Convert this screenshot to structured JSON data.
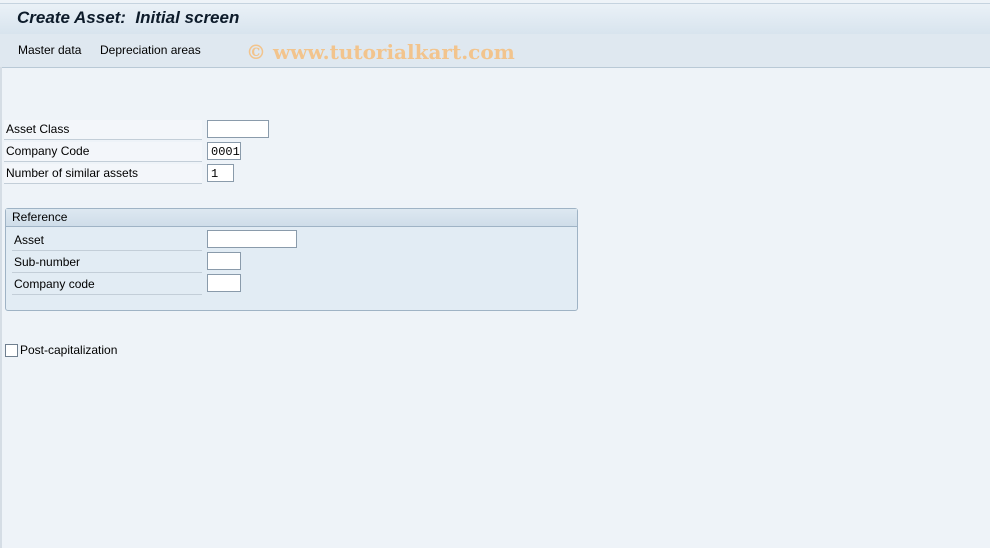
{
  "window": {
    "title": "Create Asset:  Initial screen"
  },
  "menu": {
    "items": [
      "Master data",
      "Depreciation areas"
    ]
  },
  "watermark": "© www.tutorialkart.com",
  "main_fields": {
    "asset_class": {
      "label": "Asset Class",
      "value": ""
    },
    "company_code": {
      "label": "Company Code",
      "value": "0001"
    },
    "similar_assets": {
      "label": "Number of similar assets",
      "value": "1"
    }
  },
  "reference": {
    "title": "Reference",
    "asset": {
      "label": "Asset",
      "value": ""
    },
    "sub_number": {
      "label": "Sub-number",
      "value": ""
    },
    "company_code": {
      "label": "Company code",
      "value": ""
    }
  },
  "post_capitalization": {
    "label": "Post-capitalization",
    "checked": false
  }
}
